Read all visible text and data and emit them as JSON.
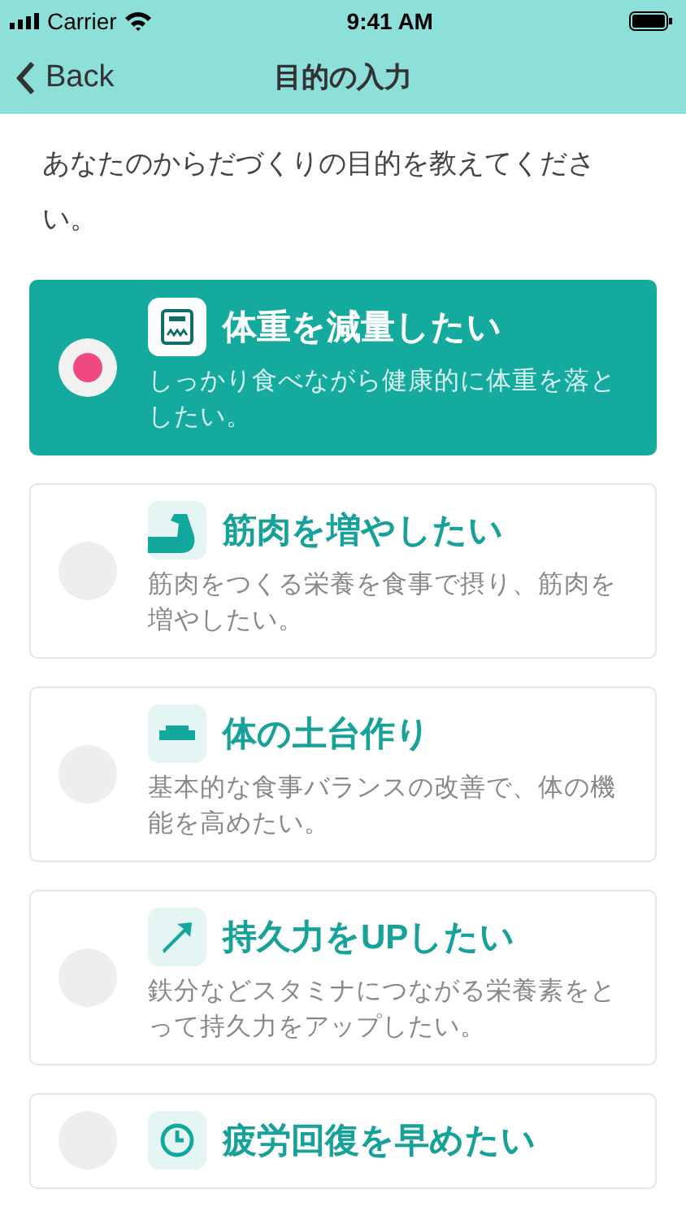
{
  "status_bar": {
    "carrier": "Carrier",
    "time": "9:41 AM"
  },
  "nav": {
    "back": "Back",
    "title": "目的の入力"
  },
  "intro": "あなたのからだづくりの目的を教えてください。",
  "options": [
    {
      "kind": "scale",
      "title": "体重を減量したい",
      "description": "しっかり食べながら健康的に体重を落としたい。",
      "selected": true
    },
    {
      "kind": "arm",
      "title": "筋肉を増やしたい",
      "description": "筋肉をつくる栄養を食事で摂り、筋肉を増やしたい。",
      "selected": false
    },
    {
      "kind": "base",
      "title": "体の土台作り",
      "description": "基本的な食事バランスの改善で、体の機能を高めたい。",
      "selected": false
    },
    {
      "kind": "arrow",
      "title": "持久力をUPしたい",
      "description": "鉄分などスタミナにつながる栄養素をとって持久力をアップしたい。",
      "selected": false
    },
    {
      "kind": "clock",
      "title": "疲労回復を早めたい",
      "selected": false
    }
  ]
}
